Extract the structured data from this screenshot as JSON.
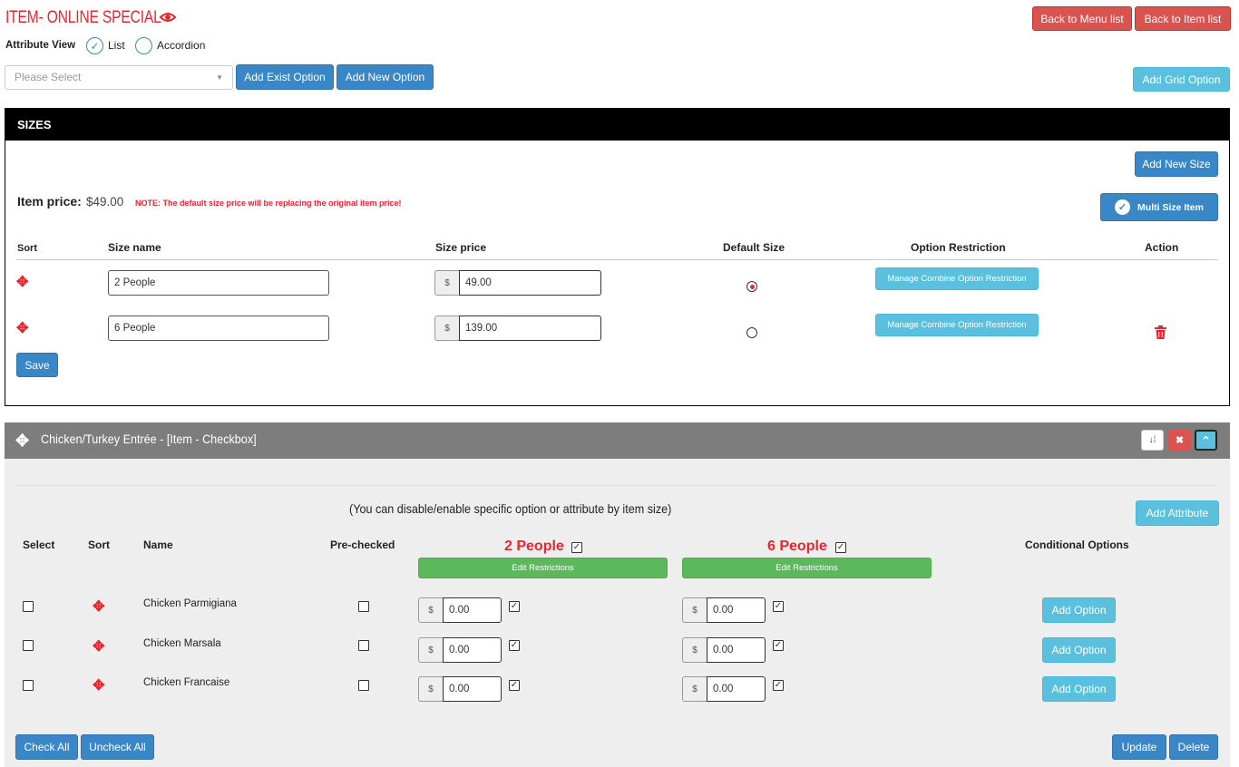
{
  "header": {
    "title": "ITEM- ONLINE SPECIAL",
    "back_menu": "Back to Menu list",
    "back_item": "Back to Item list"
  },
  "attribute_view": {
    "label": "Attribute View",
    "list": "List",
    "accordion": "Accordion",
    "selected": "List"
  },
  "toolbar": {
    "select_placeholder": "Please Select",
    "add_exist": "Add Exist Option",
    "add_new": "Add New Option",
    "add_grid": "Add Grid Option"
  },
  "sizes": {
    "title": "SIZES",
    "add_new_size": "Add New Size",
    "item_price_label": "Item price:",
    "item_price": "$49.00",
    "note": "NOTE: The default size price will be replacing the original item price!",
    "multi_size": "Multi Size Item",
    "columns": {
      "sort": "Sort",
      "size_name": "Size name",
      "size_price": "Size price",
      "default_size": "Default Size",
      "option_restriction": "Option Restriction",
      "action": "Action"
    },
    "currency": "$",
    "rows": [
      {
        "name": "2 People",
        "price": "49.00",
        "default": true,
        "restriction_btn": "Manage Combine Option Restriction"
      },
      {
        "name": "6 People",
        "price": "139.00",
        "default": false,
        "restriction_btn": "Manage Combine Option Restriction"
      }
    ],
    "save": "Save"
  },
  "attribute": {
    "title": "Chicken/Turkey Entrée - [Item - Checkbox]",
    "hint": "(You can disable/enable specific option or attribute by item size)",
    "add_attribute": "Add Attribute",
    "columns": {
      "select": "Select",
      "sort": "Sort",
      "name": "Name",
      "prechecked": "Pre-checked",
      "size1": "2 People",
      "size2": "6 People",
      "conditional": "Conditional Options"
    },
    "edit_restrictions": "Edit Restrictions",
    "currency": "$",
    "rows": [
      {
        "name": "Chicken Parmigiana",
        "price1": "0.00",
        "price2": "0.00",
        "add_option": "Add Option"
      },
      {
        "name": "Chicken Marsala",
        "price1": "0.00",
        "price2": "0.00",
        "add_option": "Add Option"
      },
      {
        "name": "Chicken Francaise",
        "price1": "0.00",
        "price2": "0.00",
        "add_option": "Add Option"
      }
    ],
    "check_all": "Check All",
    "uncheck_all": "Uncheck All",
    "update": "Update",
    "delete": "Delete"
  },
  "colors": {
    "accent_red": "#e8262d",
    "primary_blue": "#3a87c8",
    "info_cyan": "#5bc0de",
    "success_green": "#5cb85c",
    "danger_red": "#d9534f"
  },
  "icons": {
    "title_icon": "eye-icon",
    "sort_icon": "move-arrows-icon",
    "delete_icon": "trash-icon",
    "check_icon": "checkmark-icon"
  }
}
